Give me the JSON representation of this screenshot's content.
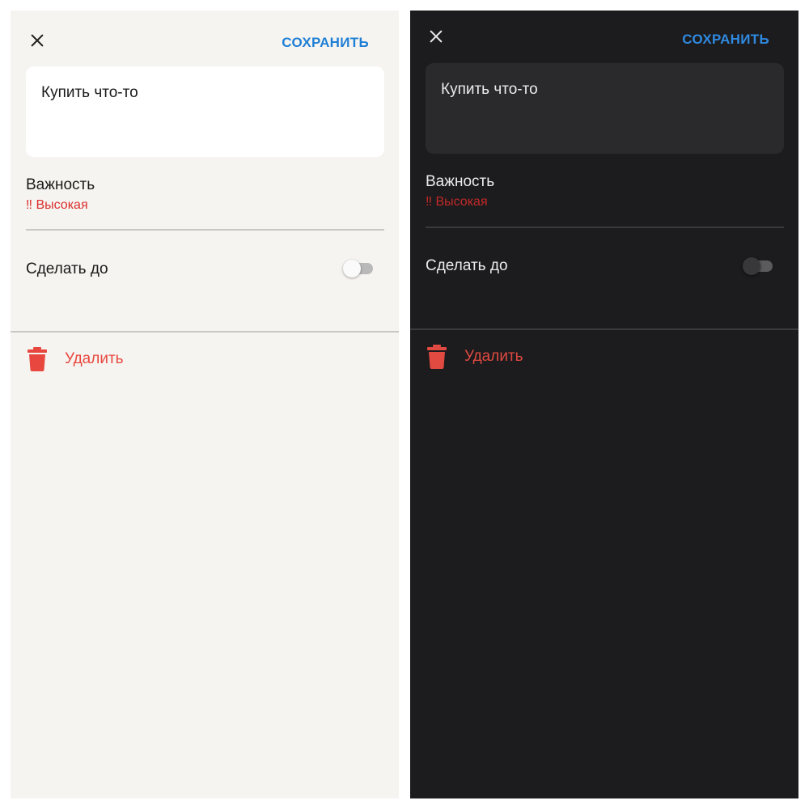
{
  "colors": {
    "accent": "#1f7fd6",
    "danger": "#d9302f",
    "light_background": "#f6f4f0",
    "dark_background": "#1c1b1d"
  },
  "panels": [
    {
      "theme": "light",
      "close_icon": "close-icon",
      "save_label": "СОХРАНИТЬ",
      "task_text": "Купить что-то",
      "importance": {
        "label": "Важность",
        "value": "‼ Высокая"
      },
      "deadline": {
        "label": "Сделать до",
        "enabled": false
      },
      "delete": {
        "label": "Удалить",
        "icon": "trash-icon"
      }
    },
    {
      "theme": "dark",
      "close_icon": "close-icon",
      "save_label": "СОХРАНИТЬ",
      "task_text": "Купить что-то",
      "importance": {
        "label": "Важность",
        "value": "‼ Высокая"
      },
      "deadline": {
        "label": "Сделать до",
        "enabled": false
      },
      "delete": {
        "label": "Удалить",
        "icon": "trash-icon"
      }
    }
  ]
}
